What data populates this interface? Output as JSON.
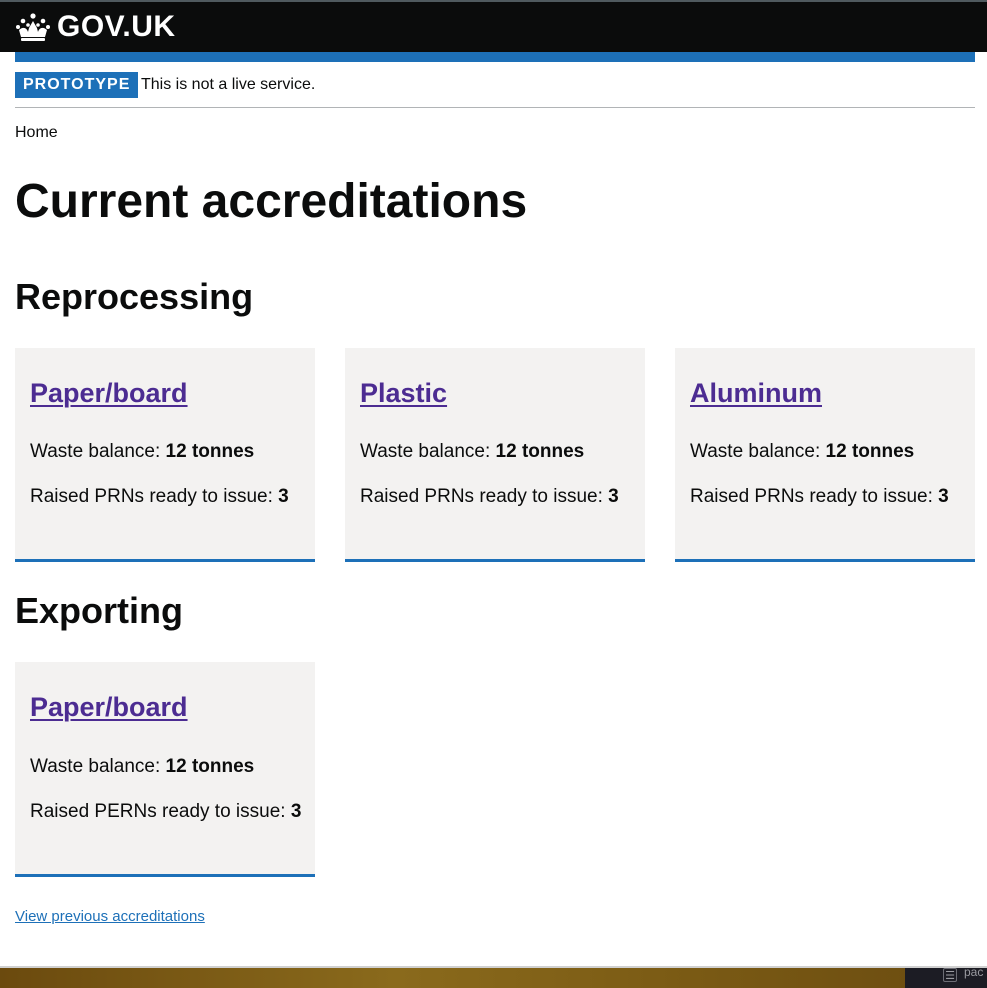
{
  "header": {
    "logo_text": "GOV.UK",
    "bg_color": "#0b0c0c",
    "bar_color": "#1d70b8"
  },
  "phase_banner": {
    "tag": "PROTOTYPE",
    "text": "This is not a live service."
  },
  "breadcrumb": {
    "home": "Home"
  },
  "page_title": "Current accreditations",
  "sections": {
    "reprocessing": {
      "heading": "Reprocessing",
      "cards": [
        {
          "title": "Paper/board",
          "waste_label": "Waste balance: ",
          "waste_value": "12 tonnes",
          "prn_label": "Raised PRNs ready to issue: ",
          "prn_value": "3"
        },
        {
          "title": "Plastic",
          "waste_label": "Waste balance: ",
          "waste_value": "12 tonnes",
          "prn_label": "Raised PRNs ready to issue: ",
          "prn_value": "3"
        },
        {
          "title": "Aluminum",
          "waste_label": "Waste balance: ",
          "waste_value": "12 tonnes",
          "prn_label": "Raised PRNs ready to issue: ",
          "prn_value": "3"
        }
      ]
    },
    "exporting": {
      "heading": "Exporting",
      "cards": [
        {
          "title": "Paper/board",
          "waste_label": "Waste balance: ",
          "waste_value": "12 tonnes",
          "prn_label": "Raised PERNs ready to issue: ",
          "prn_value": "3"
        }
      ]
    }
  },
  "previous_link": "View previous accreditations",
  "taskbar": {
    "label": "pac",
    "icon": "document-icon"
  },
  "colors": {
    "link": "#1d70b8",
    "visited_link": "#4c2c92",
    "card_bg": "#f3f2f1",
    "tag_bg": "#1d70b8"
  }
}
